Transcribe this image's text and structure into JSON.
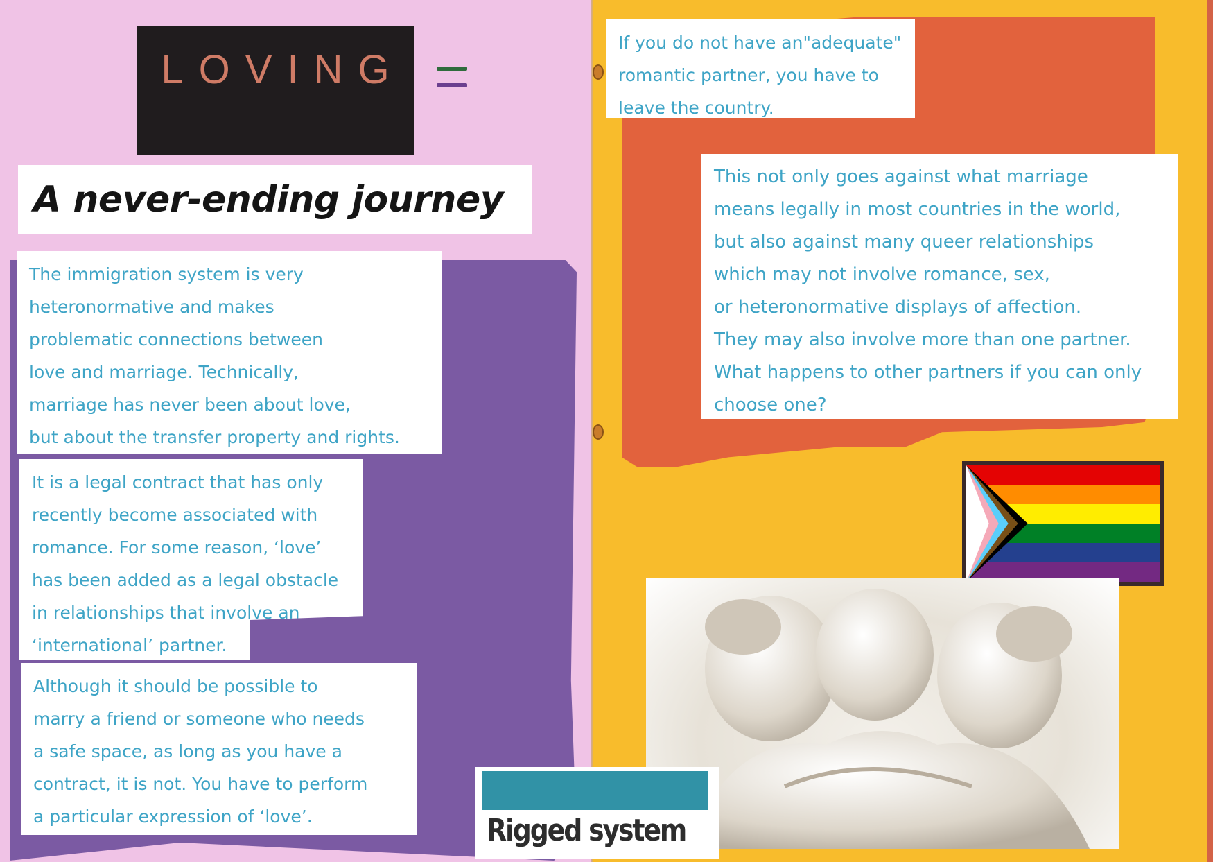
{
  "left_page": {
    "loving_label": "LOVING",
    "title": "A never-ending journey",
    "note1_lines": [
      "The immigration system is very",
      "heteronormative and makes",
      "problematic connections between",
      "love and marriage. Technically,",
      "marriage has never been about love,",
      "but about the transfer property and rights."
    ],
    "note2_lines": [
      "It is a legal contract that has only",
      "recently become associated with",
      "romance. For some reason, ‘love’",
      "has been added as a legal obstacle",
      "in relationships that involve an",
      "‘international’ partner."
    ],
    "note3_lines": [
      "Although it should be possible to",
      "marry a friend or someone who needs",
      "a safe space, as long as you have a",
      "contract, it is not. You have to perform",
      "a particular expression of ‘love’."
    ]
  },
  "right_page": {
    "note4_lines": [
      "If you do not have an\"adequate\"",
      "romantic partner, you have to",
      "leave the country."
    ],
    "note5_lines": [
      "This not only goes against what marriage",
      "means legally in most countries in the world,",
      "but also against many queer relationships",
      "which may not involve romance, sex,",
      "or heteronormative displays of affection.",
      "They may also involve more than one partner.",
      "What happens to other partners if you can only",
      "choose one?"
    ],
    "rigged_label": "Rigged system"
  },
  "images": {
    "flag": "progress-pride-flag",
    "statue": "marble-statue-embracing-figures"
  },
  "colors": {
    "left_page": "#f0c3e6",
    "right_page": "#f8bc2c",
    "purple_paper": "#7b5aa3",
    "orange_paper": "#e2623d",
    "note_text": "#3ea4c6",
    "loving_text": "#cf7b66",
    "equals_top": "#2f6b3c",
    "equals_bottom": "#6b3f8f"
  }
}
